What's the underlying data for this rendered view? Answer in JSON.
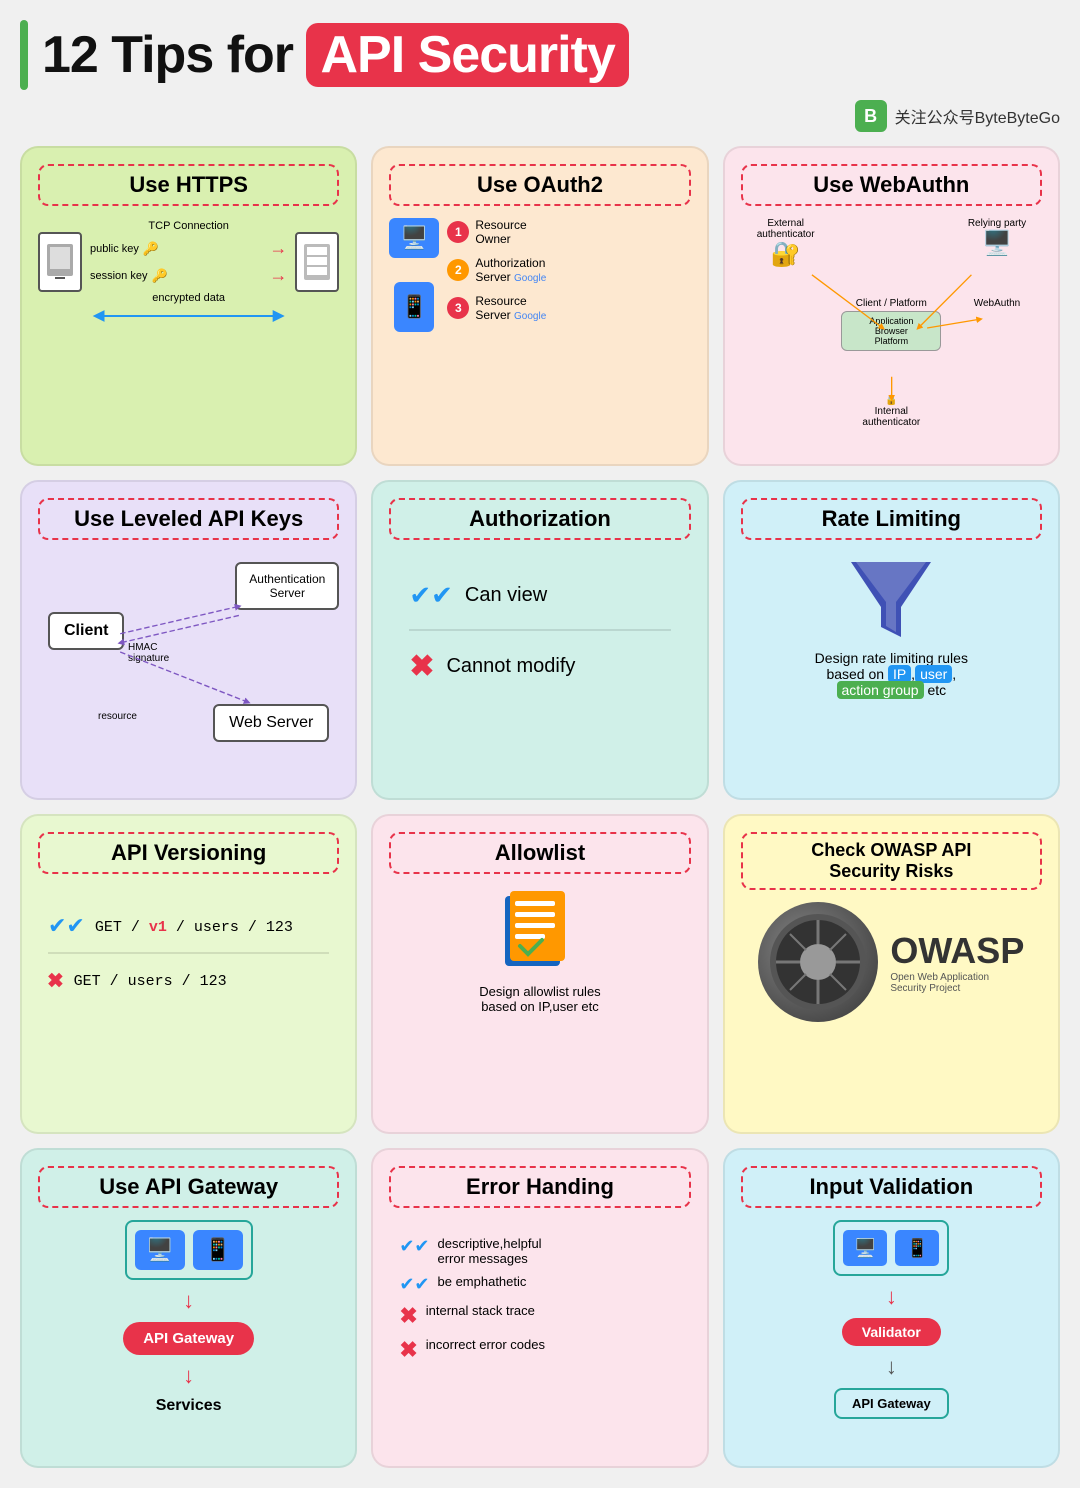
{
  "header": {
    "title_prefix": "12 Tips for ",
    "title_highlight": "API Security",
    "bar_color": "#4CAF50"
  },
  "branding": {
    "text": "关注公众号ByteByteGo",
    "logo": "B"
  },
  "cards": {
    "https": {
      "title": "Use HTTPS",
      "rows": [
        {
          "label": "TCP Connection",
          "arrow": "↔"
        },
        {
          "label": "public key",
          "arrow": "→",
          "icon": "🔑"
        },
        {
          "label": "session key",
          "arrow": "→",
          "icon": "🔑"
        },
        {
          "label": "encrypted data",
          "arrow": "↔"
        }
      ]
    },
    "oauth2": {
      "title": "Use OAuth2",
      "items": [
        {
          "num": "1",
          "label": "Resource Owner"
        },
        {
          "num": "2",
          "label": "Authorization Server"
        },
        {
          "num": "3",
          "label": "Resource Server"
        }
      ]
    },
    "webauthn": {
      "title": "Use WebAuthn",
      "nodes": [
        {
          "label": "External authenticator"
        },
        {
          "label": "Relying party"
        },
        {
          "label": "Client / Platform"
        },
        {
          "label": "Application Browser Platform"
        },
        {
          "label": "WebAuthn"
        },
        {
          "label": "Internal authenticator"
        }
      ]
    },
    "apikeys": {
      "title": "Use Leveled API Keys",
      "nodes": {
        "client": "Client",
        "auth": "Authentication\nServer",
        "web": "Web Server",
        "hmac": "HMAC\nsignature",
        "resource": "resource"
      }
    },
    "authorization": {
      "title": "Authorization",
      "items": [
        {
          "icon": "✔✔",
          "label": "Can view",
          "type": "check"
        },
        {
          "icon": "✖",
          "label": "Cannot modify",
          "type": "x"
        }
      ]
    },
    "ratelimiting": {
      "title": "Rate Limiting",
      "description": "Design rate limiting rules based on",
      "highlights": [
        "IP",
        "user",
        "action group"
      ],
      "suffix": "etc"
    },
    "versioning": {
      "title": "API Versioning",
      "items": [
        {
          "icon": "✔✔",
          "label": "GET / v1 / users / 123",
          "highlight": "v1",
          "type": "check"
        },
        {
          "icon": "✖",
          "label": "GET / users / 123",
          "type": "x"
        }
      ]
    },
    "allowlist": {
      "title": "Allowlist",
      "description": "Design allowlist rules\nbased on IP,user etc"
    },
    "owasp": {
      "title": "Check OWASP API\nSecurity Risks",
      "logo_text": "OWASP",
      "subtitle": "Open Web Application\nSecurity Project"
    },
    "gateway": {
      "title": "Use API Gateway",
      "gateway_label": "API Gateway",
      "services_label": "Services"
    },
    "errorhandling": {
      "title": "Error Handing",
      "items": [
        {
          "icon": "✔✔",
          "label": "descriptive,helpful\nerror messages",
          "type": "check"
        },
        {
          "icon": "✔✔",
          "label": "be emphathetic",
          "type": "check"
        },
        {
          "icon": "✖",
          "label": "internal stack trace",
          "type": "x"
        },
        {
          "icon": "✖",
          "label": "incorrect error codes",
          "type": "x"
        }
      ]
    },
    "inputvalidation": {
      "title": "Input Validation",
      "validator_label": "Validator",
      "gateway_label": "API Gateway"
    }
  }
}
